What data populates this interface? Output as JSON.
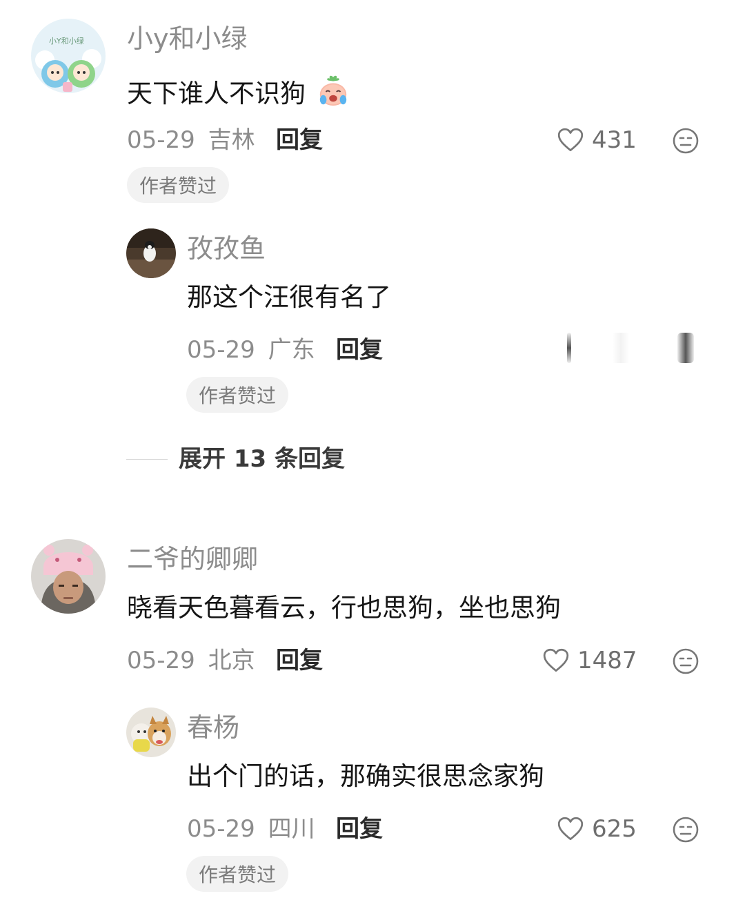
{
  "comments": [
    {
      "username": "小y和小绿",
      "avatar_text": "小Y和小绿",
      "content": "天下谁人不识狗",
      "content_emoji": "crying-face-emoji",
      "date": "05-29",
      "location": "吉林",
      "reply_label": "回复",
      "likes": "431",
      "badge": "作者赞过",
      "replies": [
        {
          "username": "孜孜鱼",
          "content": "那这个汪很有名了",
          "date": "05-29",
          "location": "广东",
          "reply_label": "回复",
          "badge": "作者赞过"
        }
      ],
      "expand_label": "展开 13 条回复"
    },
    {
      "username": "二爷的卿卿",
      "content": "晓看天色暮看云，行也思狗，坐也思狗",
      "date": "05-29",
      "location": "北京",
      "reply_label": "回复",
      "likes": "1487",
      "replies": [
        {
          "username": "春杨",
          "content": "出个门的话，那确实很思念家狗",
          "date": "05-29",
          "location": "四川",
          "reply_label": "回复",
          "likes": "625",
          "badge": "作者赞过"
        }
      ]
    }
  ],
  "colors": {
    "meta_gray": "#8c8c8c",
    "badge_bg": "#f2f2f2"
  }
}
